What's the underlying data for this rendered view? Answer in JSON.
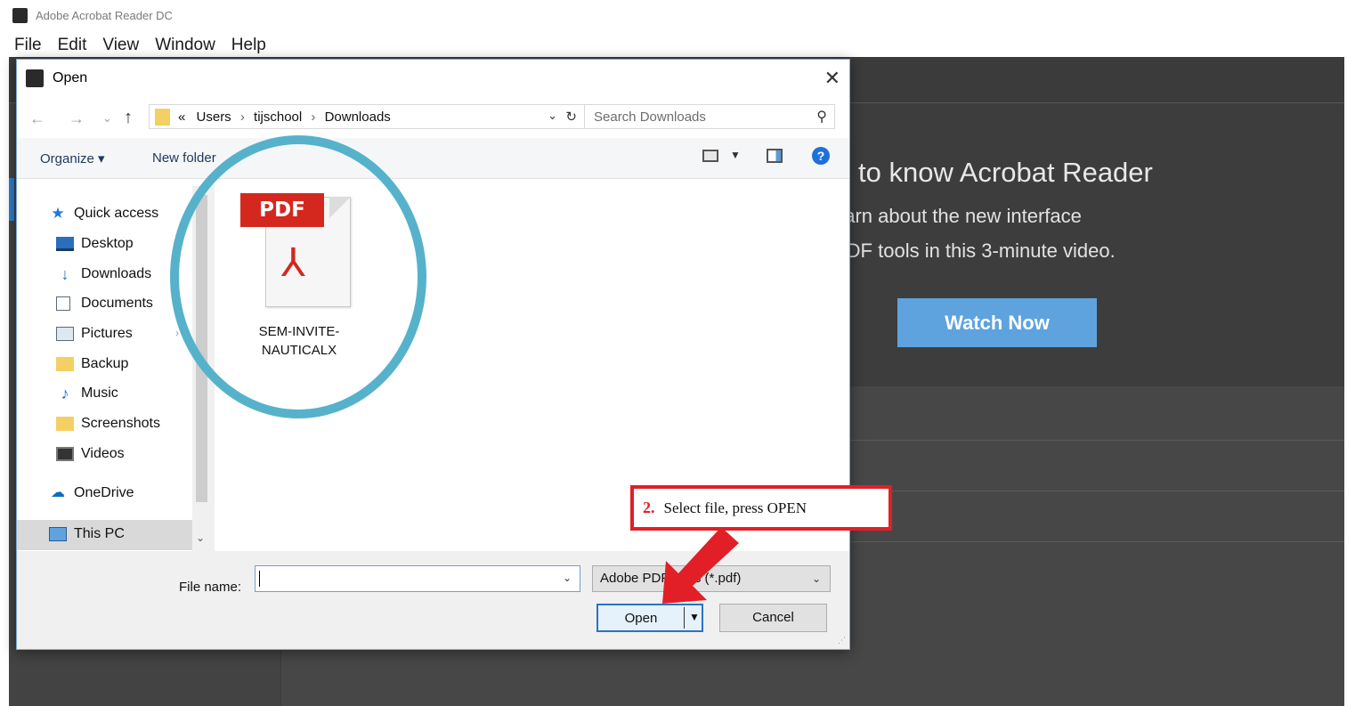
{
  "app": {
    "title": "Adobe Acrobat Reader DC",
    "menu": [
      "File",
      "Edit",
      "View",
      "Window",
      "Help"
    ]
  },
  "welcome": {
    "title": "to know Acrobat Reader",
    "line1": "earn about the new interface",
    "line2": "PDF tools in this 3-minute video.",
    "watch_button": "Watch Now"
  },
  "dialog": {
    "title": "Open",
    "close_glyph": "✕",
    "nav": {
      "back": "←",
      "forward": "→",
      "recent": "⌄",
      "up": "↑"
    },
    "address": {
      "prefix": "«",
      "crumbs": [
        "Users",
        "tijschool",
        "Downloads"
      ],
      "separator": "›"
    },
    "search": {
      "placeholder": "Search Downloads",
      "icon_glyph": "⚲"
    },
    "toolbar": {
      "organize": "Organize ▾",
      "new_folder": "New folder",
      "help_glyph": "?"
    },
    "tree": [
      {
        "label": "Quick access",
        "icon": "star-icon",
        "glyph": "★"
      },
      {
        "label": "Desktop",
        "icon": "desktop-icon",
        "glyph": ""
      },
      {
        "label": "Downloads",
        "icon": "download-icon",
        "glyph": "↓"
      },
      {
        "label": "Documents",
        "icon": "document-icon",
        "glyph": "≣"
      },
      {
        "label": "Pictures",
        "icon": "pictures-icon",
        "glyph": ""
      },
      {
        "label": "Backup",
        "icon": "folder-icon",
        "glyph": ""
      },
      {
        "label": "Music",
        "icon": "music-icon",
        "glyph": "♪"
      },
      {
        "label": "Screenshots",
        "icon": "folder-icon",
        "glyph": ""
      },
      {
        "label": "Videos",
        "icon": "video-icon",
        "glyph": ""
      },
      {
        "label": "OneDrive",
        "icon": "cloud-icon",
        "glyph": "☁"
      },
      {
        "label": "This PC",
        "icon": "computer-icon",
        "glyph": ""
      }
    ],
    "file": {
      "badge": "PDF",
      "acrobat_glyph": "⅄",
      "name_line1": "SEM-INVITE-",
      "name_line2": "NAUTICALX"
    },
    "filename_label": "File name:",
    "filename_value": "",
    "filetype": "Adobe PDF Files (*.pdf)",
    "open_button": "Open",
    "cancel_button": "Cancel"
  },
  "callout": {
    "number": "2.",
    "text": "Select file, press OPEN",
    "color": "#e21f26"
  },
  "colors": {
    "highlight_ring": "#56b2cb",
    "accent_blue": "#5ea3dd",
    "pdf_red": "#d4281f"
  }
}
